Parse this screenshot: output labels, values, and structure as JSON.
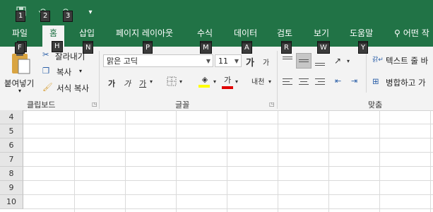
{
  "qat": {
    "save_keytip": "1",
    "undo_keytip": "2",
    "redo_keytip": "3",
    "customize": "▾"
  },
  "tabs": [
    {
      "label": "파일",
      "keytip": "F"
    },
    {
      "label": "홈",
      "keytip": "H"
    },
    {
      "label": "삽입",
      "keytip": "N"
    },
    {
      "label": "페이지 레이아웃",
      "keytip": "P"
    },
    {
      "label": "수식",
      "keytip": "M"
    },
    {
      "label": "데이터",
      "keytip": "A"
    },
    {
      "label": "검토",
      "keytip": "R"
    },
    {
      "label": "보기",
      "keytip": "W"
    },
    {
      "label": "도움말",
      "keytip": "Y"
    },
    {
      "label": "어떤 작"
    }
  ],
  "clipboard": {
    "paste_label": "붙여넣기",
    "cut_label": "잘라내기",
    "copy_label": "복사",
    "format_painter_label": "서식 복사",
    "group_label": "클립보드"
  },
  "font": {
    "font_name": "맑은 고딕",
    "font_size": "11",
    "grow_font": "가",
    "shrink_font": "가",
    "bold": "가",
    "italic": "가",
    "underline": "가",
    "font_color_glyph": "가",
    "phonetic": "내천",
    "group_label": "글꼴"
  },
  "alignment": {
    "wrap_text_label": "텍스트 줄 바",
    "merge_label": "병합하고 가",
    "group_label": "맞춤"
  },
  "rows": [
    "4",
    "5",
    "6",
    "7",
    "8",
    "9",
    "10"
  ],
  "colors": {
    "accent": "#217346",
    "ribbon_bg": "#f3f3f3",
    "fill_yellow": "#ffff00",
    "font_red": "#e00000"
  }
}
